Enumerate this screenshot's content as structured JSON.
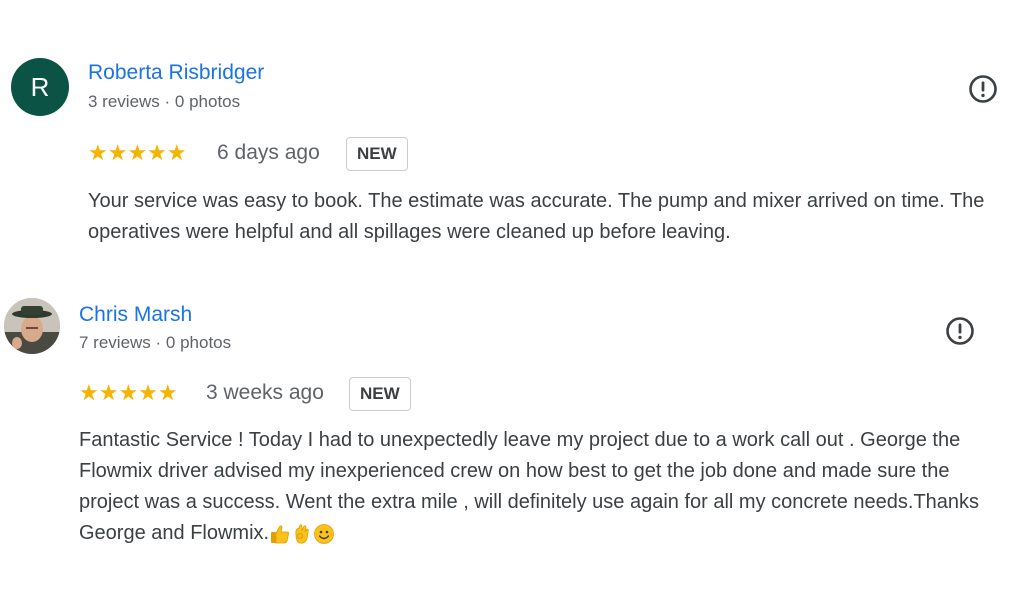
{
  "reviews": [
    {
      "avatar_letter": "R",
      "avatar_color": "#0b5345",
      "name": "Roberta Risbridger",
      "meta": "3 reviews · 0 photos",
      "rating": 5,
      "stars": "★★★★★",
      "date": "6 days ago",
      "badge": "NEW",
      "text": "Your service was easy to book. The estimate was accurate. The pump and mixer arrived on time. The operatives were helpful and all spillages were cleaned up before leaving."
    },
    {
      "avatar_letter": "",
      "name": "Chris Marsh",
      "meta": "7 reviews · 0 photos",
      "rating": 5,
      "stars": "★★★★★",
      "date": "3 weeks ago",
      "badge": "NEW",
      "text": "Fantastic Service ! Today I had to unexpectedly leave my project due to a work call out . George the Flowmix driver advised my inexperienced crew on how best to get the job done and made sure the project was a success. Went the extra mile , will definitely use again for all my concrete needs.Thanks George and Flowmix.",
      "emojis": [
        "thumbs-up-emoji",
        "ok-hand-emoji",
        "smiling-face-emoji"
      ]
    }
  ],
  "colors": {
    "link_blue": "#1a73e8",
    "star_yellow": "#f4b400",
    "text_gray": "#3c4043",
    "meta_gray": "#5f6368"
  },
  "icons": {
    "report": "report-icon"
  }
}
